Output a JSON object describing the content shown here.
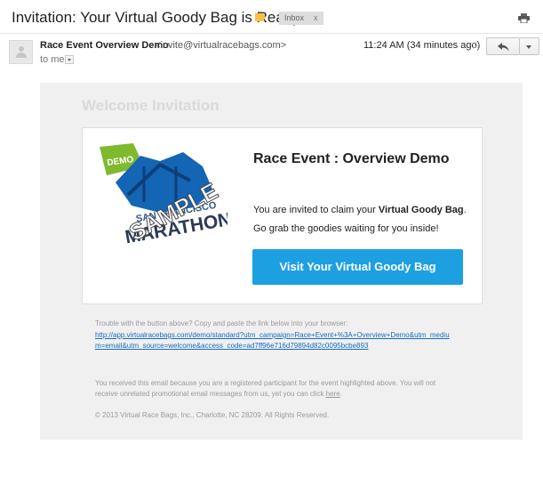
{
  "subject": {
    "title": "Invitation: Your Virtual Goody Bag is Ready",
    "label_chip": "Inbox",
    "label_close": "x"
  },
  "header": {
    "sender_name": "Race Event Overview Demo",
    "sender_email": "<invite@virtualracebags.com>",
    "recipient": "to me",
    "timestamp": "11:24 AM (34 minutes ago)"
  },
  "email": {
    "welcome_heading": "Welcome Invitation",
    "card": {
      "title": "Race Event : Overview Demo",
      "text_prefix": "You are invited to claim your ",
      "text_bold": "Virtual Goody Bag",
      "text_suffix": ".",
      "text_line2": "Go grab the goodies waiting for you inside!",
      "cta_label": "Visit Your Virtual Goody Bag",
      "logo": {
        "badge": "DEMO",
        "line1": "SAN FRANCISCO",
        "line2": "MARATHON",
        "watermark": "SAMPLE"
      }
    },
    "trouble_text": "Trouble with the button above? Copy and paste the link below into your browser:",
    "link": "http://app.virtualracebags.com/demo/standard?utm_campaign=Race+Event+%3A+Overview+Demo&utm_medium=email&utm_source=welcome&access_code=ad7ff96e716d79894d82c0095bcbe893",
    "notice_text": "You received this email because you are a registered participant for the event highlighted above. You will not receive unrelated promotional email messages from us, yet you can click ",
    "notice_link": "here",
    "notice_end": ".",
    "copyright": "© 2013 Virtual Race Bags, Inc., Charlotte, NC 28209. All Rights Reserved."
  },
  "colors": {
    "cta": "#1da0e1",
    "label_tag": "#f5c242",
    "link": "#1a6bc2"
  },
  "icons": [
    "print-icon",
    "star-icon",
    "reply-icon",
    "chevron-down-icon",
    "person-icon",
    "label-tag-icon"
  ]
}
